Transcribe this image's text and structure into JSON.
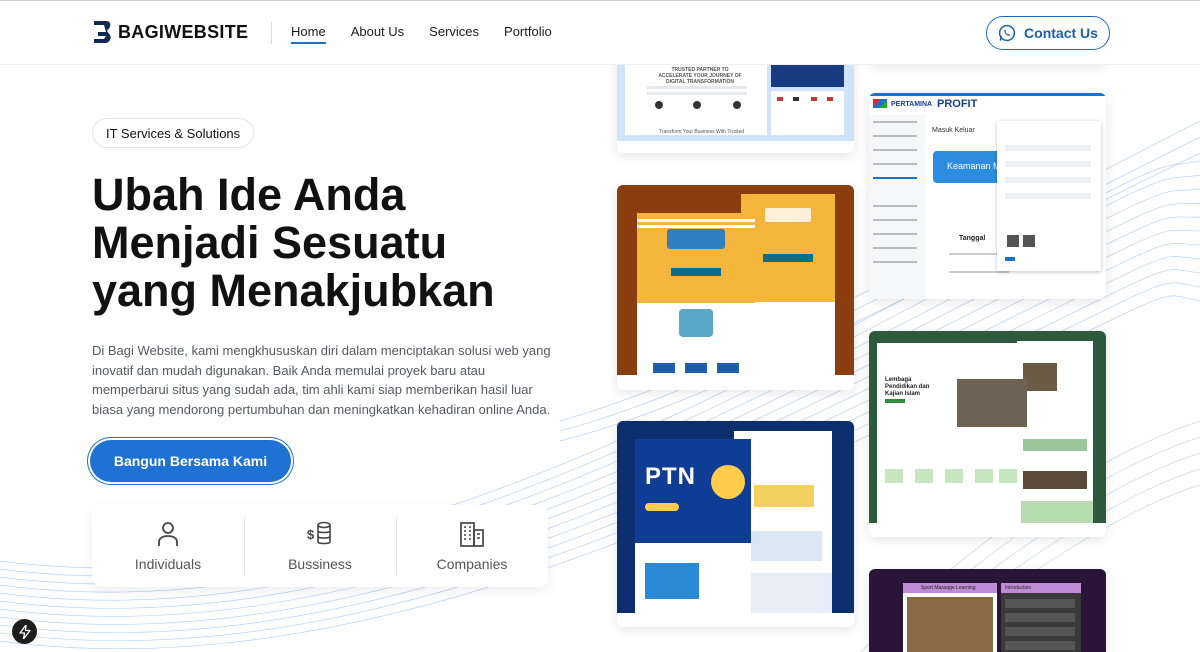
{
  "brand": {
    "name": "BAGIWEBSITE"
  },
  "nav": {
    "items": [
      {
        "label": "Home",
        "active": true
      },
      {
        "label": "About Us",
        "active": false
      },
      {
        "label": "Services",
        "active": false
      },
      {
        "label": "Portfolio",
        "active": false
      }
    ],
    "contact_label": "Contact Us",
    "contact_icon": "whatsapp-icon"
  },
  "hero": {
    "badge": "IT Services & Solutions",
    "headline_line1": "Ubah Ide Anda",
    "headline_line2": "Menjadi Sesuatu",
    "headline_line3": "yang Menakjubkan",
    "description": "Di Bagi Website, kami mengkhususkan diri dalam menciptakan solusi web yang inovatif dan mudah digunakan. Baik Anda memulai proyek baru atau memperbarui situs yang sudah ada, tim ahli kami siap memberikan hasil luar biasa yang mendorong pertumbuhan dan meningkatkan kehadiran online Anda.",
    "cta_label": "Bangun Bersama Kami"
  },
  "segments": [
    {
      "label": "Individuals",
      "icon": "person-icon"
    },
    {
      "label": "Bussiness",
      "icon": "money-icon"
    },
    {
      "label": "Companies",
      "icon": "building-icon"
    }
  ],
  "portfolio": {
    "card1_heading": "TRUSTED PARTNER TO ACCELERATE YOUR JOURNEY OF DIGITAL TRANSFORMATION",
    "card1_footer": "Transform Your Business With Trusted",
    "pertamina_brand": "PERTAMINA",
    "profit_brand": "PROFIT",
    "pertamina_breadcrumb": "Masuk Keluar",
    "pertamina_banner": "Keamanan M",
    "pertamina_col": "Tanggal",
    "ptn_title": "PTN",
    "school_title": "Lembaga Pendidikan dan Kajian Islam",
    "course_title": "Sport Massage Learning",
    "course_panel": "Introduction"
  },
  "colors": {
    "accent": "#1f72d4",
    "brand_blue": "#1a5fa8",
    "card_orange": "#f4b53c",
    "card_brown": "#8a3e0f",
    "card_navy": "#0d2e6e",
    "card_green": "#2d5a3d",
    "card_purple": "#2a1538"
  }
}
